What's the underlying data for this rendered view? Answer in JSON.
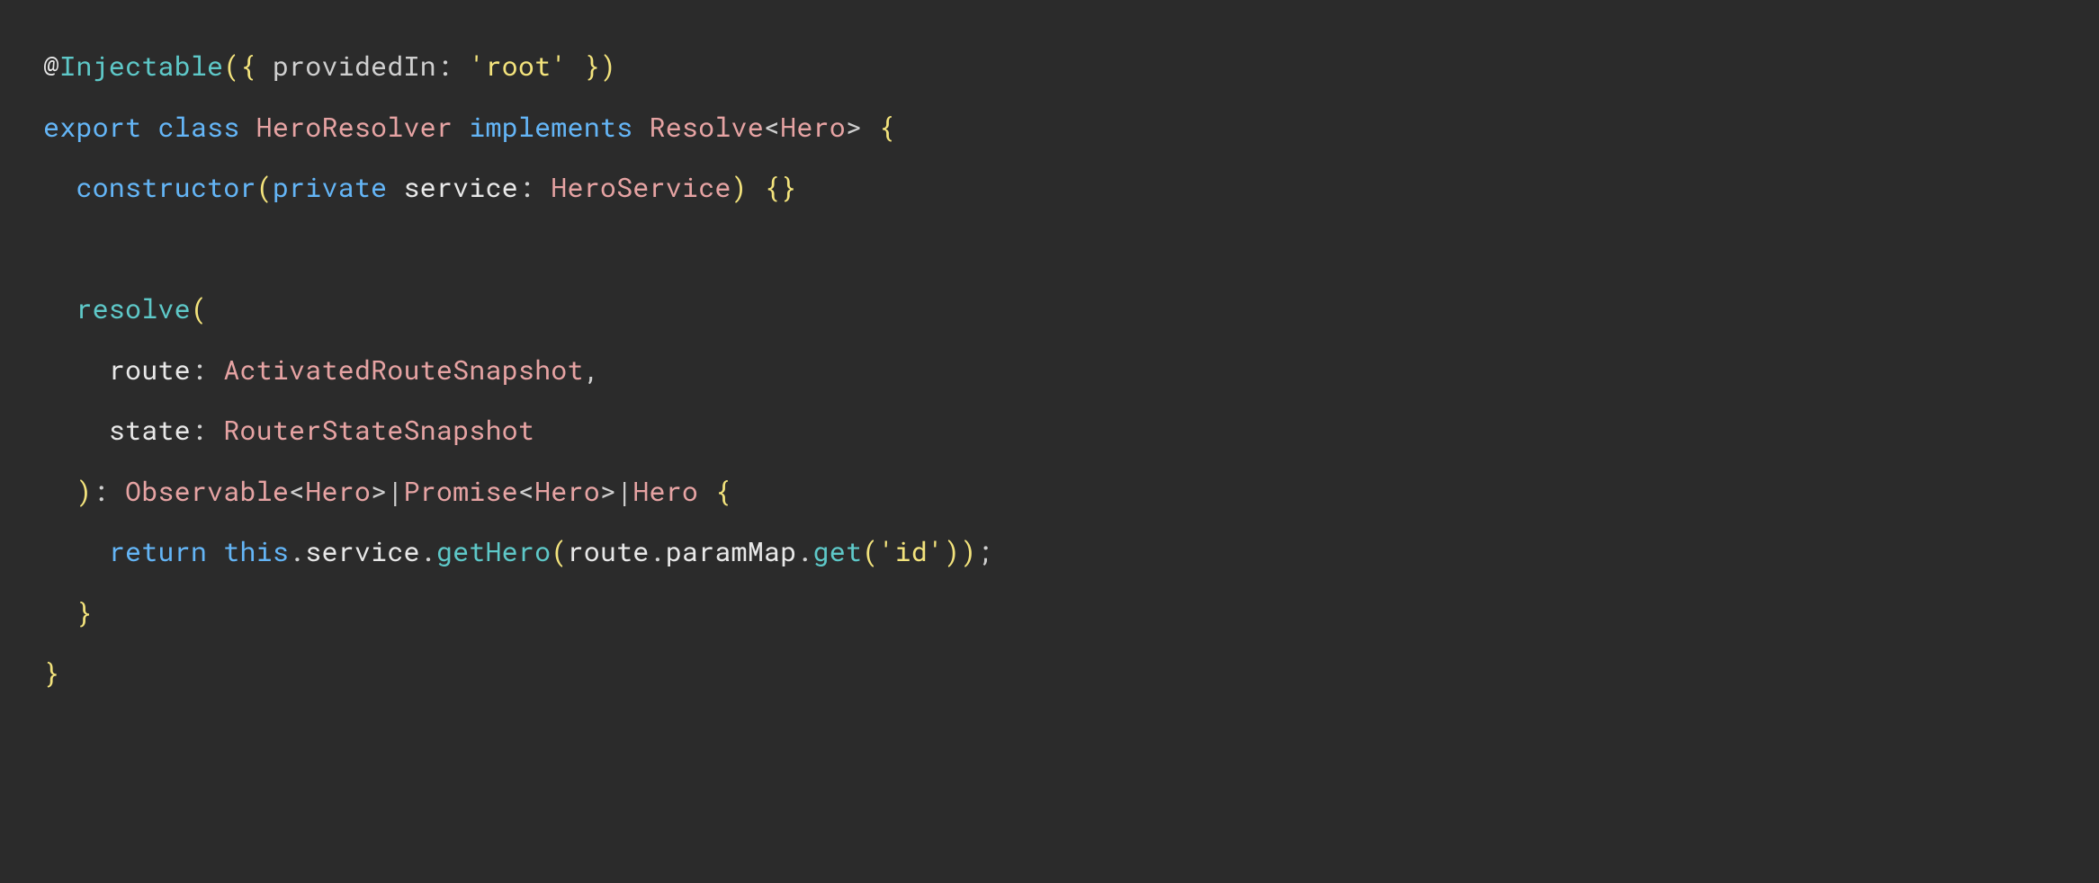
{
  "code": {
    "line1": {
      "at": "@",
      "inj": "Injectable",
      "lp": "(",
      "lb": "{ ",
      "propKey": "providedIn",
      "colon": ": ",
      "str": "'root'",
      "rb": " }",
      "rp": ")"
    },
    "line2": {
      "export": "export",
      "sp1": " ",
      "class": "class",
      "sp2": " ",
      "name": "HeroResolver",
      "sp3": " ",
      "implements": "implements",
      "sp4": " ",
      "iface": "Resolve",
      "lt": "<",
      "gparam": "Hero",
      "gt": ">",
      "sp5": " ",
      "lb": "{"
    },
    "line3": {
      "indent": "  ",
      "ctor": "constructor",
      "lp": "(",
      "priv": "private",
      "sp1": " ",
      "pname": "service",
      "colon": ": ",
      "ptype": "HeroService",
      "rp": ")",
      "sp2": " ",
      "lb": "{",
      "rb": "}"
    },
    "line4": {
      "indent": "  ",
      "method": "resolve",
      "lp": "("
    },
    "line5": {
      "indent": "    ",
      "pname": "route",
      "colon": ": ",
      "ptype": "ActivatedRouteSnapshot",
      "comma": ","
    },
    "line6": {
      "indent": "    ",
      "pname": "state",
      "colon": ": ",
      "ptype": "RouterStateSnapshot"
    },
    "line7": {
      "indent": "  ",
      "rp": ")",
      "colon": ": ",
      "t1": "Observable",
      "lt1": "<",
      "g1": "Hero",
      "gt1": ">",
      "pipe1": "|",
      "t2": "Promise",
      "lt2": "<",
      "g2": "Hero",
      "gt2": ">",
      "pipe2": "|",
      "t3": "Hero",
      "sp": " ",
      "lb": "{"
    },
    "line8": {
      "indent": "    ",
      "ret": "return",
      "sp1": " ",
      "this": "this",
      "dot1": ".",
      "svc": "service",
      "dot2": ".",
      "call": "getHero",
      "lp": "(",
      "route": "route",
      "dot3": ".",
      "pmap": "paramMap",
      "dot4": ".",
      "get": "get",
      "lp2": "(",
      "str": "'id'",
      "rp2": ")",
      "rp": ")",
      "semi": ";"
    },
    "line9": {
      "indent": "  ",
      "rb": "}"
    },
    "line10": {
      "rb": "}"
    }
  }
}
